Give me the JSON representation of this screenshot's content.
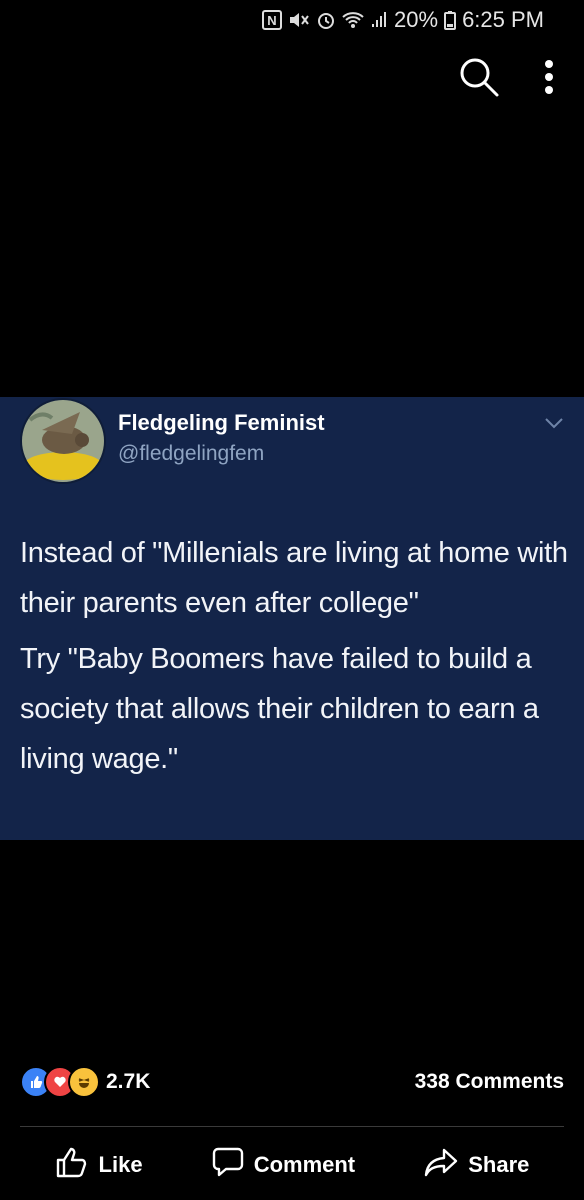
{
  "status_bar": {
    "battery": "20%",
    "time": "6:25 PM",
    "icons": [
      "nfc-icon",
      "mute-icon",
      "alarm-icon",
      "wifi-icon",
      "signal-icon",
      "battery-icon"
    ]
  },
  "toolbar": {
    "icons": [
      "search-icon",
      "more-vert-icon"
    ]
  },
  "tweet": {
    "display_name": "Fledgeling Feminist",
    "handle": "@fledgelingfem",
    "paragraphs": [
      "Instead of \"Millenials are living at home with their parents even after college\"",
      "Try \"Baby Boomers have failed to build a society that allows their children to earn a living wage.\""
    ]
  },
  "colors": {
    "background": "#000000",
    "card": "#132449",
    "handle": "#8fa4c2",
    "like_blue": "#3b82f6",
    "love_red": "#ef4444",
    "haha_yellow": "#f9c23c"
  },
  "reactions": {
    "icons": [
      "like-reaction-icon",
      "love-reaction-icon",
      "haha-reaction-icon"
    ],
    "count": "2.7K"
  },
  "comments": {
    "count_label": "338 Comments"
  },
  "actions": {
    "like": "Like",
    "comment": "Comment",
    "share": "Share"
  }
}
